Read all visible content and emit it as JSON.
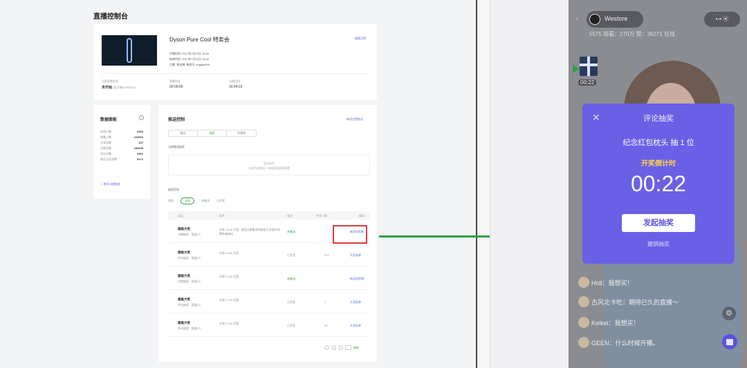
{
  "dashboard": {
    "page_title": "直播控制台",
    "event": {
      "title": "Dyson Pure Cool 特卖会",
      "edit_link": "编辑设置",
      "meta": [
        {
          "label": "开播时间",
          "value": "2017年7月22日 16:00"
        },
        {
          "label": "结束时间",
          "value": "2017年7月22日 23:00"
        },
        {
          "label": "主播",
          "value": "钱宝琳",
          "extra": "微信号 yingqita999"
        }
      ],
      "stats": [
        {
          "label": "当前直播状态",
          "value": "未开始",
          "note": "(距开播3小时33分)"
        },
        {
          "label": "直播时长",
          "value": "00:00:00"
        },
        {
          "label": "当前时间",
          "value": "16:54:23"
        }
      ]
    },
    "data_panel": {
      "title": "数据面板",
      "help_icon": "?",
      "rows": [
        {
          "label": "在线人数",
          "value": "5363"
        },
        {
          "label": "观看人数",
          "value": "263529"
        },
        {
          "label": "分享次数",
          "value": "437"
        },
        {
          "label": "点赞次数",
          "value": "183939"
        },
        {
          "label": "评论次数",
          "value": "2861"
        },
        {
          "label": "商品点击次数",
          "value": "8272"
        }
      ],
      "more_link": "↘ 更多详细数据"
    },
    "push_control": {
      "title": "推送控制",
      "link": "继续设置推送",
      "segments": [
        {
          "label": "商品",
          "active": false
        },
        {
          "label": "抽奖",
          "active": true
        },
        {
          "label": "优惠券",
          "active": false
        }
      ],
      "current_label": "当前推送抽奖",
      "empty_title": "暂无抽奖",
      "empty_desc": "当前尚未推送一场抽奖到直播间哦",
      "list_label": "抽奖列表",
      "status_label": "状态",
      "status_filters": [
        "全部",
        "未推送",
        "已开奖"
      ],
      "columns": [
        "奖品",
        "条件",
        "状态",
        "中奖人数",
        "操作"
      ],
      "rows": [
        {
          "name": "超级大奖",
          "sub": "点赞抽奖 · 奖励1人",
          "desc": "计划 15:30 开奖 - 暂定点赞最多的前若干名观众的拥有者抽出",
          "status": "未推送",
          "status_color": "#2ea04a",
          "count": "-",
          "action": "推送到直播"
        },
        {
          "name": "超级大奖",
          "sub": "评论抽奖 · 奖励1人",
          "desc": "计划 11:55 开奖",
          "status": "已开奖",
          "status_color": "#888888",
          "count": "107",
          "action": "开奖结果"
        },
        {
          "name": "超级大奖",
          "sub": "点赞抽奖 · 奖励1人",
          "desc": "计划 17:25 开奖",
          "status": "未推送",
          "status_color": "#2ea04a",
          "count": "-",
          "action": "推送到直播"
        },
        {
          "name": "超级大奖",
          "sub": "评论抽奖 · 奖励1人",
          "desc": "计划 17:20 开奖",
          "status": "已开奖",
          "status_color": "#888888",
          "count": "3",
          "action": "开奖结果"
        },
        {
          "name": "超级大奖",
          "sub": "评论抽奖 · 奖励1人",
          "desc": "计划 17:05 开奖",
          "status": "已开奖",
          "status_color": "#888888",
          "count": "20",
          "action": "开奖结果"
        }
      ],
      "pager": {
        "prev": "‹",
        "page": "1",
        "next": "›",
        "goto": "跳转"
      }
    }
  },
  "phone": {
    "account_name": "Westore",
    "viewer_stats": "5575 观看：270万 赞：36271 在线",
    "top_button": "•◦• ⦿",
    "gift_timer": "00:22",
    "lottery_modal": {
      "title": "评论抽奖",
      "close_icon": "✕",
      "prize": "纪念红包枕头  抽 1 位",
      "countdown_label": "开奖倒计时",
      "countdown": "00:22",
      "start_button": "发起抽奖",
      "cancel_link": "撤销抽奖"
    },
    "comments": [
      {
        "text": "Holl：我想买！"
      },
      {
        "text": "古风北卡吃：期待已久的直播～"
      },
      {
        "text": "Keikei：我想买！"
      },
      {
        "text": "GEEN：什么时候开播。"
      }
    ],
    "settings_icon": "⚙"
  },
  "colors": {
    "accent_green": "#2f9e44",
    "highlight_red": "#e03b3b",
    "modal_purple": "#6a60e6",
    "countdown_yellow": "#ffd24a"
  }
}
